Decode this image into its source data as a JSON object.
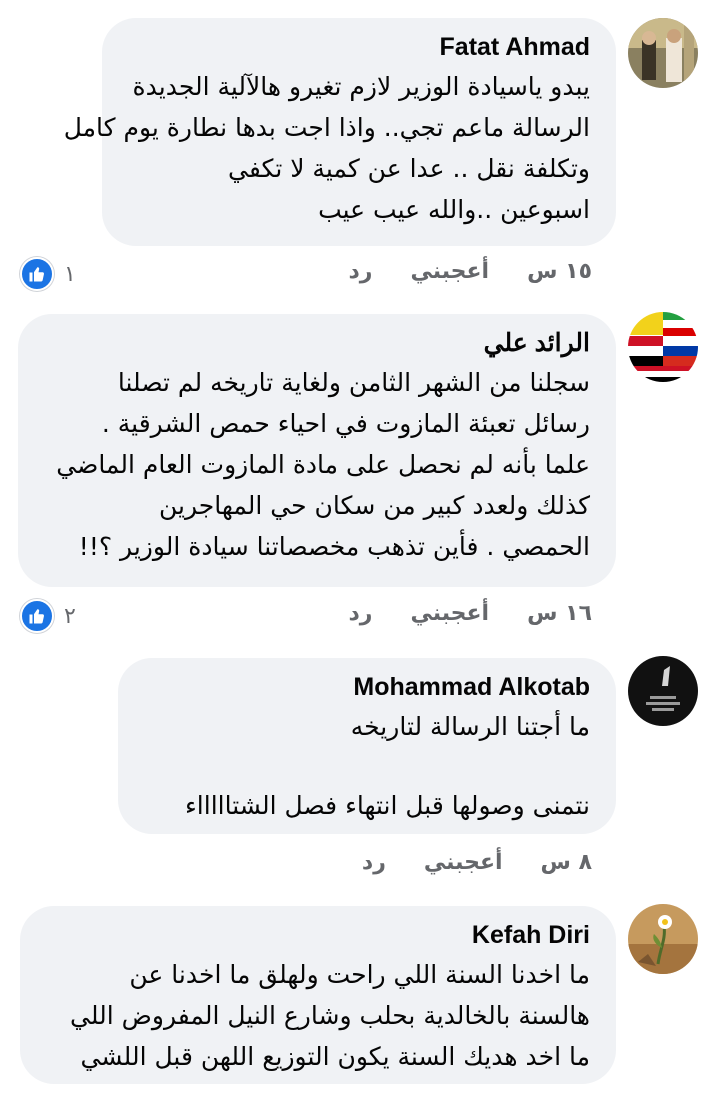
{
  "accent": "#1b74e4",
  "bubble_color": "#f0f2f5",
  "comments": [
    {
      "author": "Fatat Ahmad",
      "lines": [
        "يبدو ياسيادة الوزير لازم تغيرو هالآلية الجديدة",
        "الرسالة ماعم تجي.. واذا اجت بدها نطارة يوم كامل",
        "وتكلفة نقل .. عدا عن كمية لا تكفي",
        "اسبوعين ..والله عيب عيب"
      ],
      "time": "١٥ س",
      "like": "أعجبني",
      "reply": "رد",
      "reaction_count": "١"
    },
    {
      "author": "الرائد علي",
      "lines": [
        "سجلنا من الشهر الثامن ولغاية تاريخه لم تصلنا",
        "رسائل تعبئة المازوت في احياء حمص الشرقية .",
        "علما بأنه لم نحصل على مادة المازوت العام الماضي",
        "كذلك ولعدد كبير من سكان حي المهاجرين",
        "الحمصي . فأين تذهب مخصصاتنا سيادة الوزير ؟!!"
      ],
      "time": "١٦ س",
      "like": "أعجبني",
      "reply": "رد",
      "reaction_count": "٢"
    },
    {
      "author": "Mohammad Alkotab",
      "lines": [
        "ما أجتنا الرسالة لتاريخه",
        "نتمنى وصولها قبل انتهاء فصل الشتاااااء"
      ],
      "time": "٨ س",
      "like": "أعجبني",
      "reply": "رد"
    },
    {
      "author": "Kefah Diri",
      "lines": [
        "ما اخدنا السنة اللي راحت ولهلق ما اخدنا عن",
        "هالسنة بالخالدية بحلب وشارع النيل المفروض اللي",
        "ما اخد هديك السنة يكون التوزيع اللهن قبل اللشي"
      ]
    }
  ]
}
